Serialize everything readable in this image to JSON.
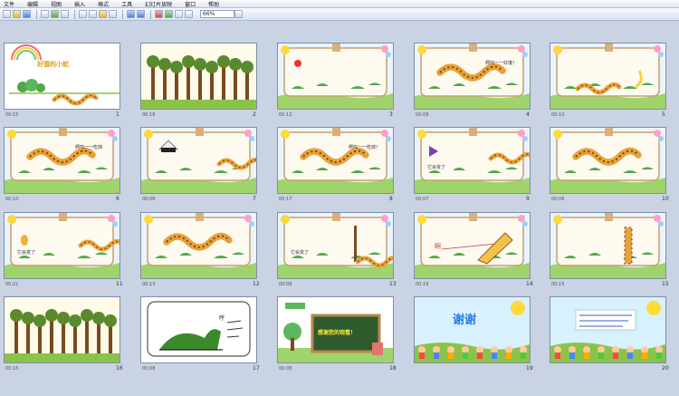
{
  "menu": [
    "文件",
    "编辑",
    "视图",
    "插入",
    "格式",
    "工具",
    "幻灯片放映",
    "窗口",
    "帮助"
  ],
  "toolbar": {
    "zoom": "66%"
  },
  "slides": [
    {
      "num": "1",
      "time": "00:15",
      "kind": "title",
      "text": "好饿的小蛇"
    },
    {
      "num": "2",
      "time": "00:18",
      "kind": "forest"
    },
    {
      "num": "3",
      "time": "00:13",
      "kind": "apple"
    },
    {
      "num": "4",
      "time": "00:08",
      "kind": "snake",
      "text": "啊呜一一好饿！"
    },
    {
      "num": "5",
      "time": "00:10",
      "kind": "banana"
    },
    {
      "num": "6",
      "time": "00:10",
      "kind": "snake",
      "text": "啊呜一一吃掉"
    },
    {
      "num": "7",
      "time": "00:08",
      "kind": "rice"
    },
    {
      "num": "8",
      "time": "00:17",
      "kind": "snake",
      "text": "啊呜一一吃掉！"
    },
    {
      "num": "9",
      "time": "00:07",
      "kind": "triangle",
      "text": "它会变了"
    },
    {
      "num": "10",
      "time": "00:08",
      "kind": "snake"
    },
    {
      "num": "11",
      "time": "00:21",
      "kind": "pineapple",
      "text": "它会变了"
    },
    {
      "num": "12",
      "time": "00:13",
      "kind": "snake"
    },
    {
      "num": "13",
      "time": "00:08",
      "kind": "tree",
      "text": "它会变了"
    },
    {
      "num": "14",
      "time": "00:19",
      "kind": "bigsnake",
      "text": "啊"
    },
    {
      "num": "15",
      "time": "00:15",
      "kind": "tall"
    },
    {
      "num": "16",
      "time": "00:15",
      "kind": "forest"
    },
    {
      "num": "17",
      "time": "00:08",
      "kind": "green",
      "text": "呼"
    },
    {
      "num": "18",
      "time": "00:08",
      "kind": "board",
      "text": "感谢您的观看！"
    },
    {
      "num": "19",
      "time": "",
      "kind": "thanks",
      "text": "谢谢"
    },
    {
      "num": "20",
      "time": "",
      "kind": "contact"
    }
  ]
}
